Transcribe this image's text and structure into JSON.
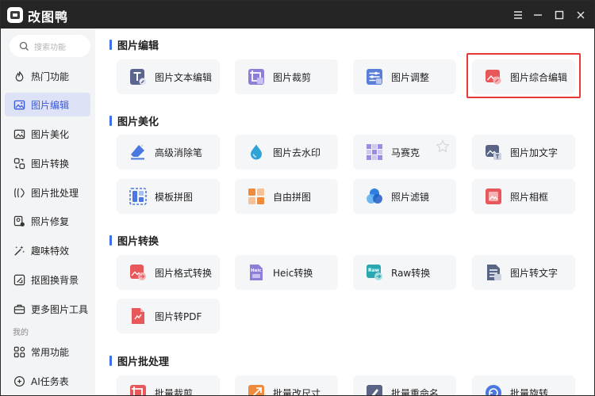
{
  "app": {
    "title": "改图鸭"
  },
  "window": {
    "menu_icon": "☰",
    "minimize_icon": "—",
    "maximize_icon": "☐",
    "close_icon": "✕"
  },
  "sidebar": {
    "search_placeholder": "搜索功能",
    "items": [
      {
        "label": "热门功能",
        "icon": "flame-icon"
      },
      {
        "label": "图片编辑",
        "icon": "image-edit-icon",
        "active": true
      },
      {
        "label": "图片美化",
        "icon": "image-beautify-icon"
      },
      {
        "label": "图片转换",
        "icon": "convert-icon"
      },
      {
        "label": "图片批处理",
        "icon": "batch-icon"
      },
      {
        "label": "照片修复",
        "icon": "photo-repair-icon"
      },
      {
        "label": "趣味特效",
        "icon": "magic-icon"
      },
      {
        "label": "抠图换背景",
        "icon": "cutout-icon"
      },
      {
        "label": "更多图片工具",
        "icon": "toolbox-icon"
      }
    ],
    "mine_section": "我的",
    "mine_items": [
      {
        "label": "常用功能",
        "icon": "grid-icon"
      },
      {
        "label": "AI任务表",
        "icon": "ai-task-icon"
      }
    ]
  },
  "sections": [
    {
      "title": "图片编辑",
      "cards": [
        {
          "label": "图片文本编辑",
          "icon": "text-edit-icon"
        },
        {
          "label": "图片裁剪",
          "icon": "crop-icon"
        },
        {
          "label": "图片调整",
          "icon": "adjust-icon"
        },
        {
          "label": "图片综合编辑",
          "icon": "comprehensive-edit-icon",
          "highlighted": true
        }
      ]
    },
    {
      "title": "图片美化",
      "cards": [
        {
          "label": "高级消除笔",
          "icon": "eraser-icon"
        },
        {
          "label": "图片去水印",
          "icon": "watermark-icon"
        },
        {
          "label": "马赛克",
          "icon": "mosaic-icon",
          "starred": true
        },
        {
          "label": "图片加文字",
          "icon": "add-text-icon"
        },
        {
          "label": "模板拼图",
          "icon": "template-collage-icon"
        },
        {
          "label": "自由拼图",
          "icon": "free-collage-icon"
        },
        {
          "label": "照片滤镜",
          "icon": "filter-icon"
        },
        {
          "label": "照片相框",
          "icon": "frame-icon"
        }
      ]
    },
    {
      "title": "图片转换",
      "cards": [
        {
          "label": "图片格式转换",
          "icon": "format-convert-icon"
        },
        {
          "label": "Heic转换",
          "icon": "heic-icon"
        },
        {
          "label": "Raw转换",
          "icon": "raw-icon"
        },
        {
          "label": "图片转文字",
          "icon": "ocr-icon"
        },
        {
          "label": "图片转PDF",
          "icon": "pdf-icon"
        }
      ]
    },
    {
      "title": "图片批处理",
      "cards": [
        {
          "label": "批量裁剪",
          "icon": "batch-crop-icon"
        },
        {
          "label": "批量改尺寸",
          "icon": "batch-resize-icon"
        },
        {
          "label": "批量重命名",
          "icon": "batch-rename-icon"
        },
        {
          "label": "批量旋转",
          "icon": "batch-rotate-icon"
        }
      ]
    }
  ],
  "colors": {
    "accent": "#3d5ad8",
    "highlight": "#e53935",
    "titlebar": "#252525"
  }
}
